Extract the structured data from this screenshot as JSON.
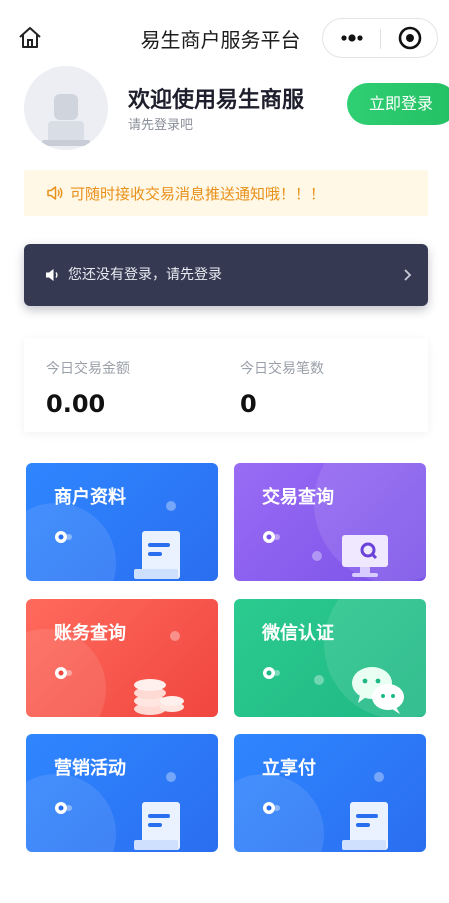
{
  "nav": {
    "title": "易生商户服务平台",
    "home_icon": "home-icon",
    "more_icon": "more-dots-icon",
    "close_icon": "mini-program-close-icon"
  },
  "profile": {
    "welcome": "欢迎使用易生商服",
    "hint": "请先登录吧",
    "login_button": "立即登录"
  },
  "notice": {
    "text": "可随时接收交易消息推送通知哦！！！",
    "icon": "speaker-outline-icon",
    "color": "#e8901a"
  },
  "login_bar": {
    "text": "您还没有登录，请先登录",
    "icon": "speaker-icon",
    "chevron": "chevron-right-icon"
  },
  "stats": {
    "amount_label": "今日交易金额",
    "amount_value": "0.00",
    "count_label": "今日交易笔数",
    "count_value": "0"
  },
  "tiles": [
    {
      "label": "商户资料",
      "icon": "document-icon",
      "color": "#2f7cf6"
    },
    {
      "label": "交易查询",
      "icon": "monitor-search-icon",
      "color": "#8a5cf0"
    },
    {
      "label": "账务查询",
      "icon": "coins-icon",
      "color": "#f4584f"
    },
    {
      "label": "微信认证",
      "icon": "wechat-icon",
      "color": "#22c08a"
    },
    {
      "label": "营销活动",
      "icon": "document-icon",
      "color": "#2f7cf6"
    },
    {
      "label": "立享付",
      "icon": "document-icon",
      "color": "#2f7cf6"
    }
  ]
}
